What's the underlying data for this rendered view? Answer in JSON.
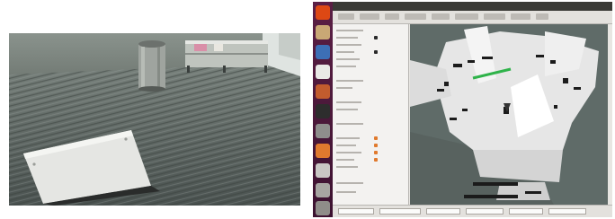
{
  "figure": {
    "left_panel": {
      "description_kind": "camera-photo",
      "icons": [
        "trash-bin",
        "service-cart",
        "laptop-screen"
      ]
    },
    "right_panel": {
      "description_kind": "rviz-occupancy-map",
      "colors": {
        "free_space": "#f2f2f2",
        "unknown_space": "#5b6766",
        "obstacles": "#1a1a1a",
        "detected_line": "#2fb34a",
        "launcher": "#4a1a3a"
      },
      "launcher_icons": [
        "ubuntu-icon",
        "files-icon",
        "browser-icon",
        "office-icon",
        "terminal-icon",
        "settings-icon",
        "text-editor-icon",
        "rviz-icon",
        "software-icon",
        "trash-icon"
      ]
    }
  }
}
